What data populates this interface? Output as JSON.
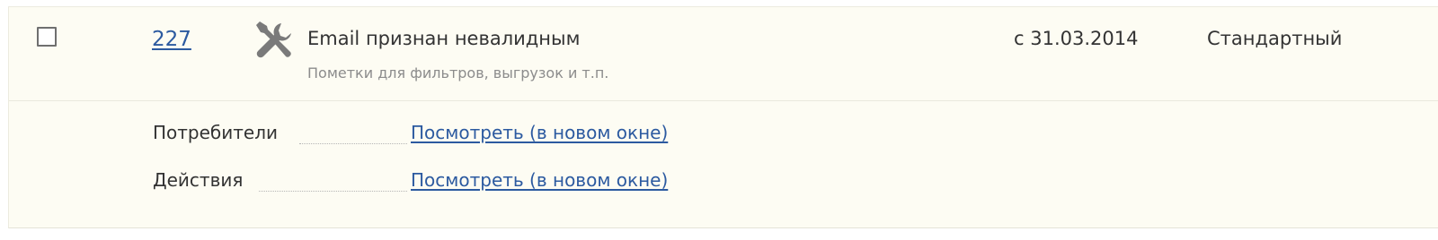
{
  "record": {
    "id": "227",
    "icon": "tools-icon",
    "title": "Email признан невалидным",
    "subtitle": "Пометки для фильтров, выгрузок и т.п.",
    "date": "с 31.03.2014",
    "type": "Стандартный",
    "checked": false
  },
  "details": [
    {
      "label": "Потребители",
      "link": "Посмотреть (в новом окне)"
    },
    {
      "label": "Действия",
      "link": "Посмотреть (в новом окне)"
    }
  ],
  "colors": {
    "panel_background": "#fdfcf3",
    "link": "#2c5aa0",
    "text": "#333333",
    "muted": "#8c8c8c",
    "icon": "#7a7a7a"
  }
}
